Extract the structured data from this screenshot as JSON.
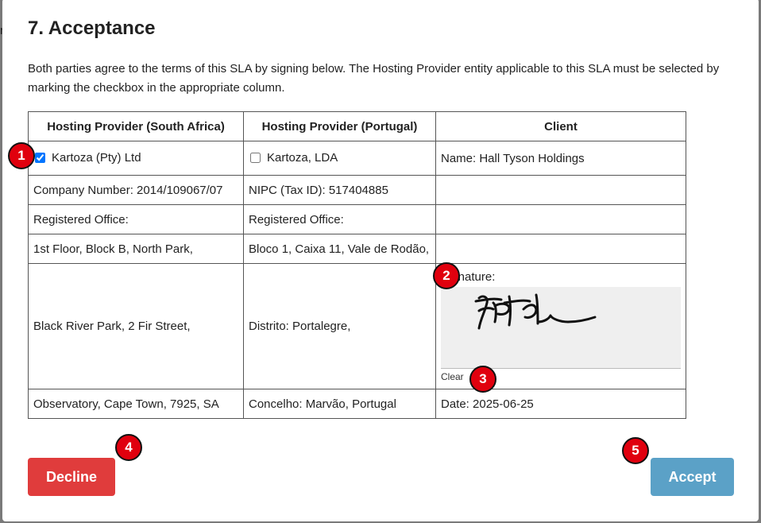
{
  "section": {
    "title": "7. Acceptance",
    "intro": "Both parties agree to the terms of this SLA by signing below. The Hosting Provider entity applicable to this SLA must be selected by marking the checkbox in the appropriate column."
  },
  "table": {
    "headers": [
      "Hosting Provider (South Africa)",
      "Hosting Provider (Portugal)",
      "Client"
    ],
    "south_africa": {
      "checkbox_label": "Kartoza (Pty) Ltd",
      "checked": true,
      "company_number": "Company Number: 2014/109067/07",
      "registered_office": "Registered Office:",
      "address_1": "1st Floor, Block B, North Park,",
      "address_2": "Black River Park, 2 Fir Street,",
      "address_3": "Observatory, Cape Town, 7925, SA"
    },
    "portugal": {
      "checkbox_label": "Kartoza, LDA",
      "checked": false,
      "tax_id": "NIPC (Tax ID): 517404885",
      "registered_office": "Registered Office:",
      "address_1": "Bloco 1, Caixa 11, Vale de Rodão,",
      "address_2": "Distrito: Portalegre,",
      "address_3": "Concelho: Marvão, Portugal"
    },
    "client": {
      "name": "Name: Hall Tyson Holdings",
      "signature_label": "Signature:",
      "clear_label": "Clear",
      "date": "Date: 2025-06-25"
    }
  },
  "buttons": {
    "decline": "Decline",
    "accept": "Accept",
    "decline_color": "#e03c3c",
    "accept_color": "#5ba1c7"
  },
  "markers": [
    "1",
    "2",
    "3",
    "4",
    "5"
  ]
}
